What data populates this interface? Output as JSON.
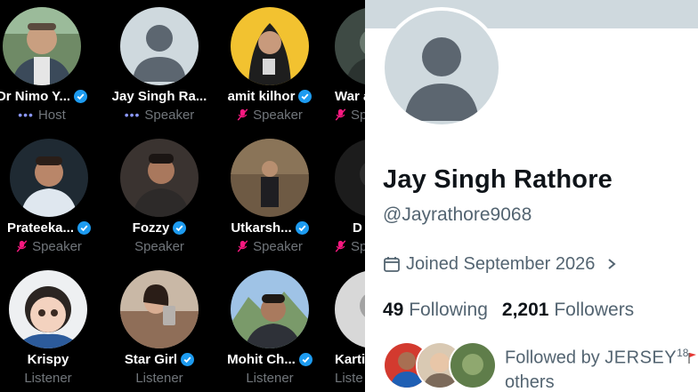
{
  "grid": {
    "rows": [
      [
        {
          "name": "Dr Nimo Y...",
          "verified": true,
          "role": "Host",
          "role_icon": "dots-icon"
        },
        {
          "name": "Jay Singh Ra...",
          "verified": false,
          "role": "Speaker",
          "role_icon": "dots-icon"
        },
        {
          "name": "amit kilhor",
          "verified": true,
          "role": "Speaker",
          "role_icon": "mic-off-icon"
        },
        {
          "name": "War a",
          "verified": false,
          "role": "Sp",
          "role_icon": "mic-off-icon"
        }
      ],
      [
        {
          "name": "Prateeka...",
          "verified": true,
          "role": "Speaker",
          "role_icon": "mic-off-icon"
        },
        {
          "name": "Fozzy",
          "verified": true,
          "role": "Speaker",
          "role_icon": "none"
        },
        {
          "name": "Utkarsh...",
          "verified": true,
          "role": "Speaker",
          "role_icon": "mic-off-icon"
        },
        {
          "name": "D",
          "verified": false,
          "role": "Sp",
          "role_icon": "mic-off-icon"
        }
      ],
      [
        {
          "name": "Krispy",
          "verified": false,
          "role": "Listener",
          "role_icon": "none"
        },
        {
          "name": "Star Girl",
          "verified": true,
          "role": "Listener",
          "role_icon": "none"
        },
        {
          "name": "Mohit Ch...",
          "verified": true,
          "role": "Listener",
          "role_icon": "none"
        },
        {
          "name": "Karti",
          "verified": false,
          "role": "Liste",
          "role_icon": "none"
        }
      ]
    ]
  },
  "profile": {
    "display_name": "Jay Singh Rathore",
    "handle": "@Jayrathore9068",
    "joined": "Joined September 2026",
    "following_count": "49",
    "following_label": "Following",
    "followers_count": "2,201",
    "followers_label": "Followers",
    "followed_by_prefix": "Followed by",
    "followed_by_accounts": "JERSEY",
    "followed_by_superscript": "18",
    "followed_by_suffix": "others"
  },
  "colors": {
    "verified": "#1d9bf0",
    "mic_off": "#f91880",
    "host_dots": "#8b98ff",
    "muted_text": "#71767b",
    "profile_muted": "#536471",
    "profile_text": "#0f1419"
  }
}
